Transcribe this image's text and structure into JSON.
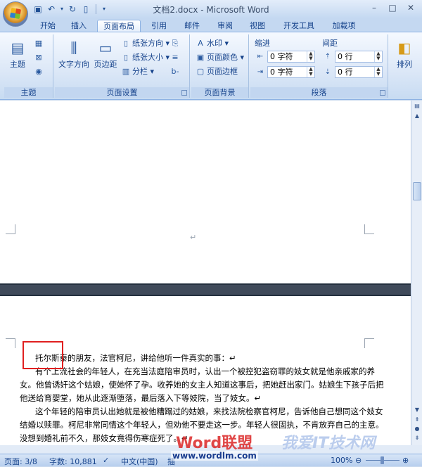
{
  "window": {
    "title": "文档2.docx - Microsoft Word",
    "controls": [
      "–",
      "□",
      "✕"
    ]
  },
  "quick_access": [
    "save-icon",
    "undo-icon",
    "redo-icon",
    "new-icon"
  ],
  "tabs": [
    "开始",
    "插入",
    "页面布局",
    "引用",
    "邮件",
    "审阅",
    "视图",
    "开发工具",
    "加载项"
  ],
  "active_tab": "页面布局",
  "ribbon": {
    "theme_group": {
      "label": "主题",
      "button": "主题"
    },
    "page_setup_group": {
      "label": "页面设置",
      "text_direction": "文字方向",
      "margins": "页边距",
      "orientation": "纸张方向",
      "size": "纸张大小",
      "columns": "分栏"
    },
    "page_bg_group": {
      "label": "页面背景",
      "watermark": "水印",
      "page_color": "页面颜色",
      "page_borders": "页面边框"
    },
    "paragraph_group": {
      "label": "段落",
      "indent_label": "缩进",
      "spacing_label": "间距",
      "indent_left": "0 字符",
      "indent_right": "0 字符",
      "spacing_before": "0 行",
      "spacing_after": "0 行"
    },
    "arrange": {
      "label": "排列"
    }
  },
  "document": {
    "page1_mark": "↵",
    "paragraphs": [
      "托尔斯泰的朋友，法官柯尼，讲给他听一件真实的事：↵",
      "有个上流社会的年轻人，在充当法庭陪审员时，认出一个被控犯盗窃罪的妓女就是他亲戚家的养女。他曾诱奸这个姑娘，使她怀了孕。收养她的女主人知道这事后，把她赶出家门。姑娘生下孩子后把他送给育婴堂，她从此逐渐堕落，最后落入下等妓院，当了妓女。↵",
      "这个年轻的陪审员认出她就是被他糟蹋过的姑娘，来找法院检察官柯尼，告诉他自己想同这个妓女结婚以赎罪。柯尼非常同情这个年轻人，但劝他不要走这一步。年轻人很固执，不肯放弃自己的主意。没想到婚礼前不久，那妓女竟得伤寒症死了。↵"
    ]
  },
  "statusbar": {
    "page": "页面: 3/8",
    "words": "字数: 10,881",
    "language": "中文(中国)",
    "insert": "插",
    "zoom": "100%"
  },
  "watermarks": {
    "brand": "Word联盟",
    "url": "www.wordlm.com",
    "site": "我爱IT技术网"
  }
}
